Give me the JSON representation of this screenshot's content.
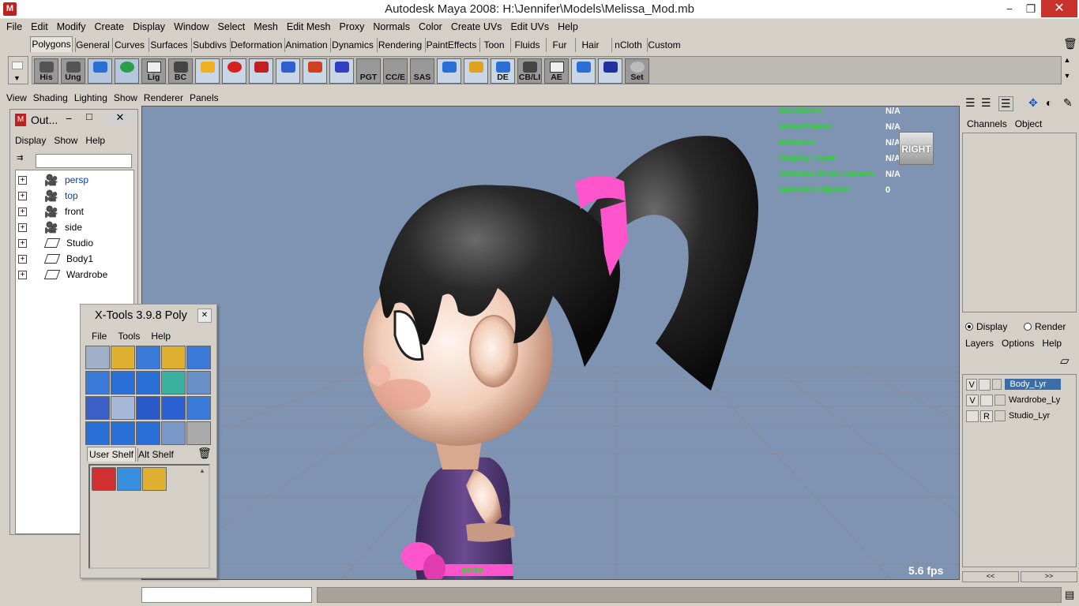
{
  "window": {
    "title": "Autodesk Maya 2008: H:\\Jennifer\\Models\\Melissa_Mod.mb",
    "minimize": "−",
    "restore": "❐",
    "close": "✕"
  },
  "menubar": [
    "File",
    "Edit",
    "Modify",
    "Create",
    "Display",
    "Window",
    "Select",
    "Mesh",
    "Edit Mesh",
    "Proxy",
    "Normals",
    "Color",
    "Create UVs",
    "Edit UVs",
    "Help"
  ],
  "shelf_tabs": [
    "Polygons",
    "General",
    "Curves",
    "Surfaces",
    "Subdivs",
    "Deformation",
    "Animation",
    "Dynamics",
    "Rendering",
    "PaintEffects",
    "Toon",
    "Fluids",
    "Fur",
    "Hair",
    "nCloth",
    "Custom"
  ],
  "shelf_tools": [
    "His",
    "Ung",
    "",
    "",
    "Lig",
    "BC",
    "",
    "",
    "",
    "",
    "",
    "",
    "PGT",
    "CC/E",
    "SAS",
    "",
    "",
    "DE",
    "CB/LI",
    "AE",
    "",
    "",
    "Set"
  ],
  "panel_menu": [
    "View",
    "Shading",
    "Lighting",
    "Show",
    "Renderer",
    "Panels"
  ],
  "hud": {
    "labels": [
      "Backfaces:",
      "Smoothness:",
      "Instance:",
      "Display Layer:",
      "Distance From Camera:",
      "Selected Objects:"
    ],
    "values": [
      "N/A",
      "N/A",
      "N/A",
      "N/A",
      "N/A",
      "0"
    ],
    "view_cube": "RIGHT",
    "fps": "5.6 fps",
    "camera_name": "persp"
  },
  "outliner": {
    "title": "Out...",
    "menu": [
      "Display",
      "Show",
      "Help"
    ],
    "items": [
      {
        "name": "persp",
        "type": "camera"
      },
      {
        "name": "top",
        "type": "camera"
      },
      {
        "name": "front",
        "type": "camera"
      },
      {
        "name": "side",
        "type": "camera"
      },
      {
        "name": "Studio",
        "type": "transform"
      },
      {
        "name": "Body1",
        "type": "transform"
      },
      {
        "name": "Wardrobe",
        "type": "transform"
      }
    ]
  },
  "xtools": {
    "title": "X-Tools 3.9.8 Poly",
    "menu": [
      "File",
      "Tools",
      "Help"
    ],
    "tabs": [
      "User Shelf",
      "Alt Shelf"
    ]
  },
  "channel_box": {
    "tabs": [
      "Channels",
      "Object"
    ]
  },
  "layer_editor": {
    "modes": [
      "Display",
      "Render"
    ],
    "selected_mode": "Display",
    "menu": [
      "Layers",
      "Options",
      "Help"
    ],
    "layers": [
      {
        "vis": "V",
        "type": "",
        "name": "Body_Lyr",
        "selected": true
      },
      {
        "vis": "V",
        "type": "",
        "name": "Wardrobe_Ly",
        "selected": false
      },
      {
        "vis": "",
        "type": "R",
        "name": "Studio_Lyr",
        "selected": false
      }
    ],
    "scroll": [
      "<<",
      ">>"
    ]
  },
  "colors": {
    "viewport_bg": "#7f93b3",
    "hud_label": "#22dd22",
    "hair": "#1a1a1a",
    "skin": "#f4d7c6",
    "dress": "#5a3f7a",
    "accent_pink": "#ff55cc"
  }
}
